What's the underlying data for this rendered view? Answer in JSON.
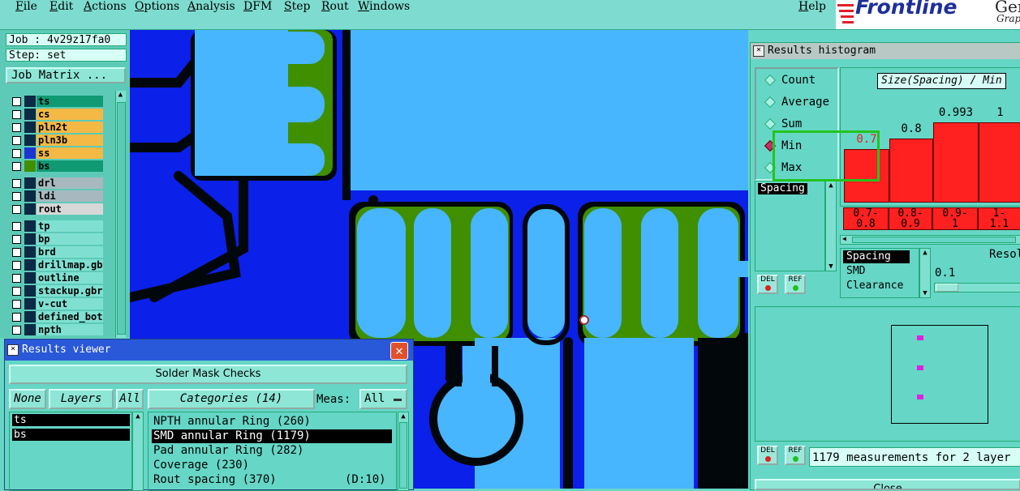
{
  "menubar": {
    "items": [
      "File",
      "Edit",
      "Actions",
      "Options",
      "Analysis",
      "DFM",
      "Step",
      "Rout",
      "Windows"
    ],
    "help": "Help",
    "logo_text": "Frontline",
    "logo_sub": "Gene",
    "logo_sub2": "Graph"
  },
  "left_panel": {
    "job": "Job : 4v29z17fa0",
    "step": "Step: set",
    "job_matrix": "Job Matrix ...",
    "layers": [
      {
        "name": "ts",
        "color": "#0f9a74"
      },
      {
        "name": "cs",
        "color": "#f3b944"
      },
      {
        "name": "pln2t",
        "color": "#f3b944"
      },
      {
        "name": "pln3b",
        "color": "#f3b944"
      },
      {
        "name": "ss",
        "color": "#f3b944"
      },
      {
        "name": "bs",
        "color": "#0f9a74"
      },
      {
        "name": "drl",
        "color": "#a7b9bf"
      },
      {
        "name": "ldi",
        "color": "#a7b9bf"
      },
      {
        "name": "rout",
        "color": "#d7d7d7"
      },
      {
        "name": "tp",
        "color": "#7fe0d1"
      },
      {
        "name": "bp",
        "color": "#7fe0d1"
      },
      {
        "name": "brd",
        "color": "#7fe0d1"
      },
      {
        "name": "drillmap.gbr",
        "color": "#7fe0d1"
      },
      {
        "name": "outline",
        "color": "#7fe0d1"
      },
      {
        "name": "stackup.gbr",
        "color": "#7fe0d1"
      },
      {
        "name": "v-cut",
        "color": "#7fe0d1"
      },
      {
        "name": "defined_bott",
        "color": "#7fe0d1"
      },
      {
        "name": "npth",
        "color": "#7fe0d1"
      }
    ]
  },
  "histogram": {
    "title": "Results histogram",
    "modes": [
      "Count",
      "Average",
      "Sum",
      "Min",
      "Max"
    ],
    "selected_mode": "Min",
    "selected_label": "Spacing",
    "header": "Size(Spacing) / Min",
    "bars": [
      {
        "value": "0.7",
        "range": "0.7-\n0.8",
        "level": 0.3
      },
      {
        "value": "0.8",
        "range": "0.8-\n0.9",
        "level": 0.36
      },
      {
        "value": "0.993",
        "range": "0.9-\n1",
        "level": 0.45
      },
      {
        "value": "1",
        "range": "1-\n1.1",
        "level": 0.45
      }
    ],
    "type_list": [
      "Spacing",
      "SMD",
      "Clearance"
    ],
    "resolution_label": "Resol",
    "resolution_value": "0.1",
    "del_label": "DEL",
    "ref_label": "REF",
    "measurement_text": "1179 measurements for 2 layer",
    "close_label": "Close"
  },
  "viewer": {
    "title": "Results viewer",
    "group": "Solder Mask Checks",
    "none_label": "None",
    "layers_label": "Layers",
    "all_label": "All",
    "categories_label": "Categories (14)",
    "meas_label": "Meas:",
    "meas_value": "All",
    "layers": [
      "ts",
      "bs"
    ],
    "categories": [
      {
        "text": "NPTH annular Ring (260)",
        "selected": false
      },
      {
        "text": "SMD annular Ring (1179)",
        "selected": true
      },
      {
        "text": "Pad annular Ring (282)",
        "selected": false
      },
      {
        "text": "Coverage (230)",
        "selected": false
      },
      {
        "text": "Rout spacing (370)          (D:10)",
        "selected": false
      }
    ]
  },
  "colors": {
    "canvas_bg": "#0b20e8",
    "pad_light": "#47b6ff",
    "pad_green": "#3f8f00",
    "dark": "#02070c",
    "highlight": "#23c41e",
    "bar": "#ff2020"
  }
}
